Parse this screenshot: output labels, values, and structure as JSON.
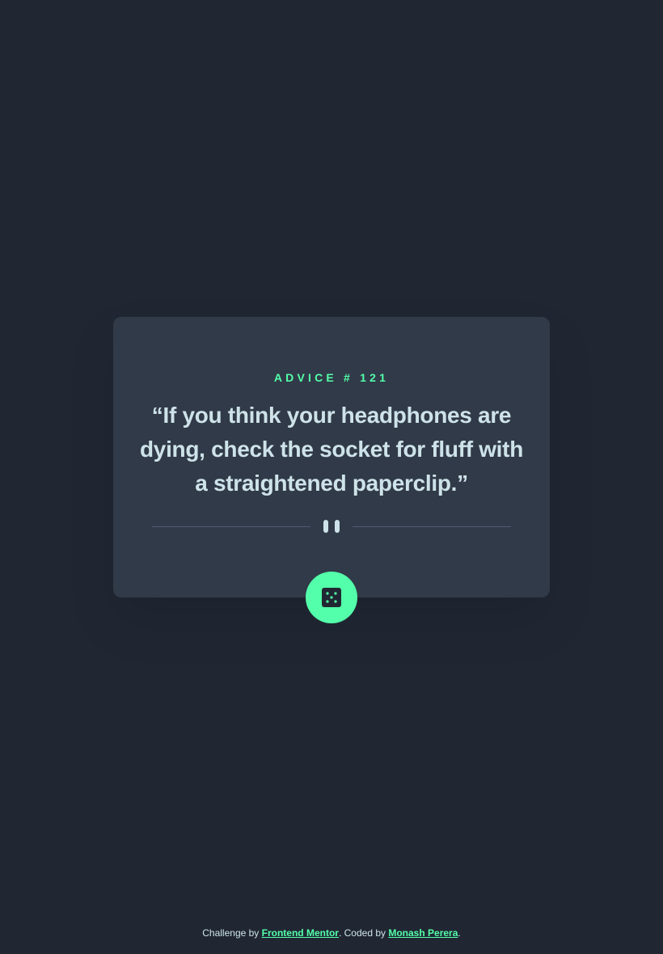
{
  "card": {
    "advice_label": "ADVICE # 121",
    "quote": "“If you think your headphones are dying, check the socket for fluff with a straightened paperclip.”"
  },
  "dice_button": {
    "icon": "dice-icon"
  },
  "footer": {
    "prefix": "Challenge by ",
    "link1": "Frontend Mentor",
    "middle": ". Coded by ",
    "link2": "Monash Perera",
    "suffix": "."
  },
  "colors": {
    "background": "#202733",
    "card": "#313a48",
    "accent": "#53ffaa",
    "text": "#cee3e9",
    "divider": "#4f5d74"
  }
}
